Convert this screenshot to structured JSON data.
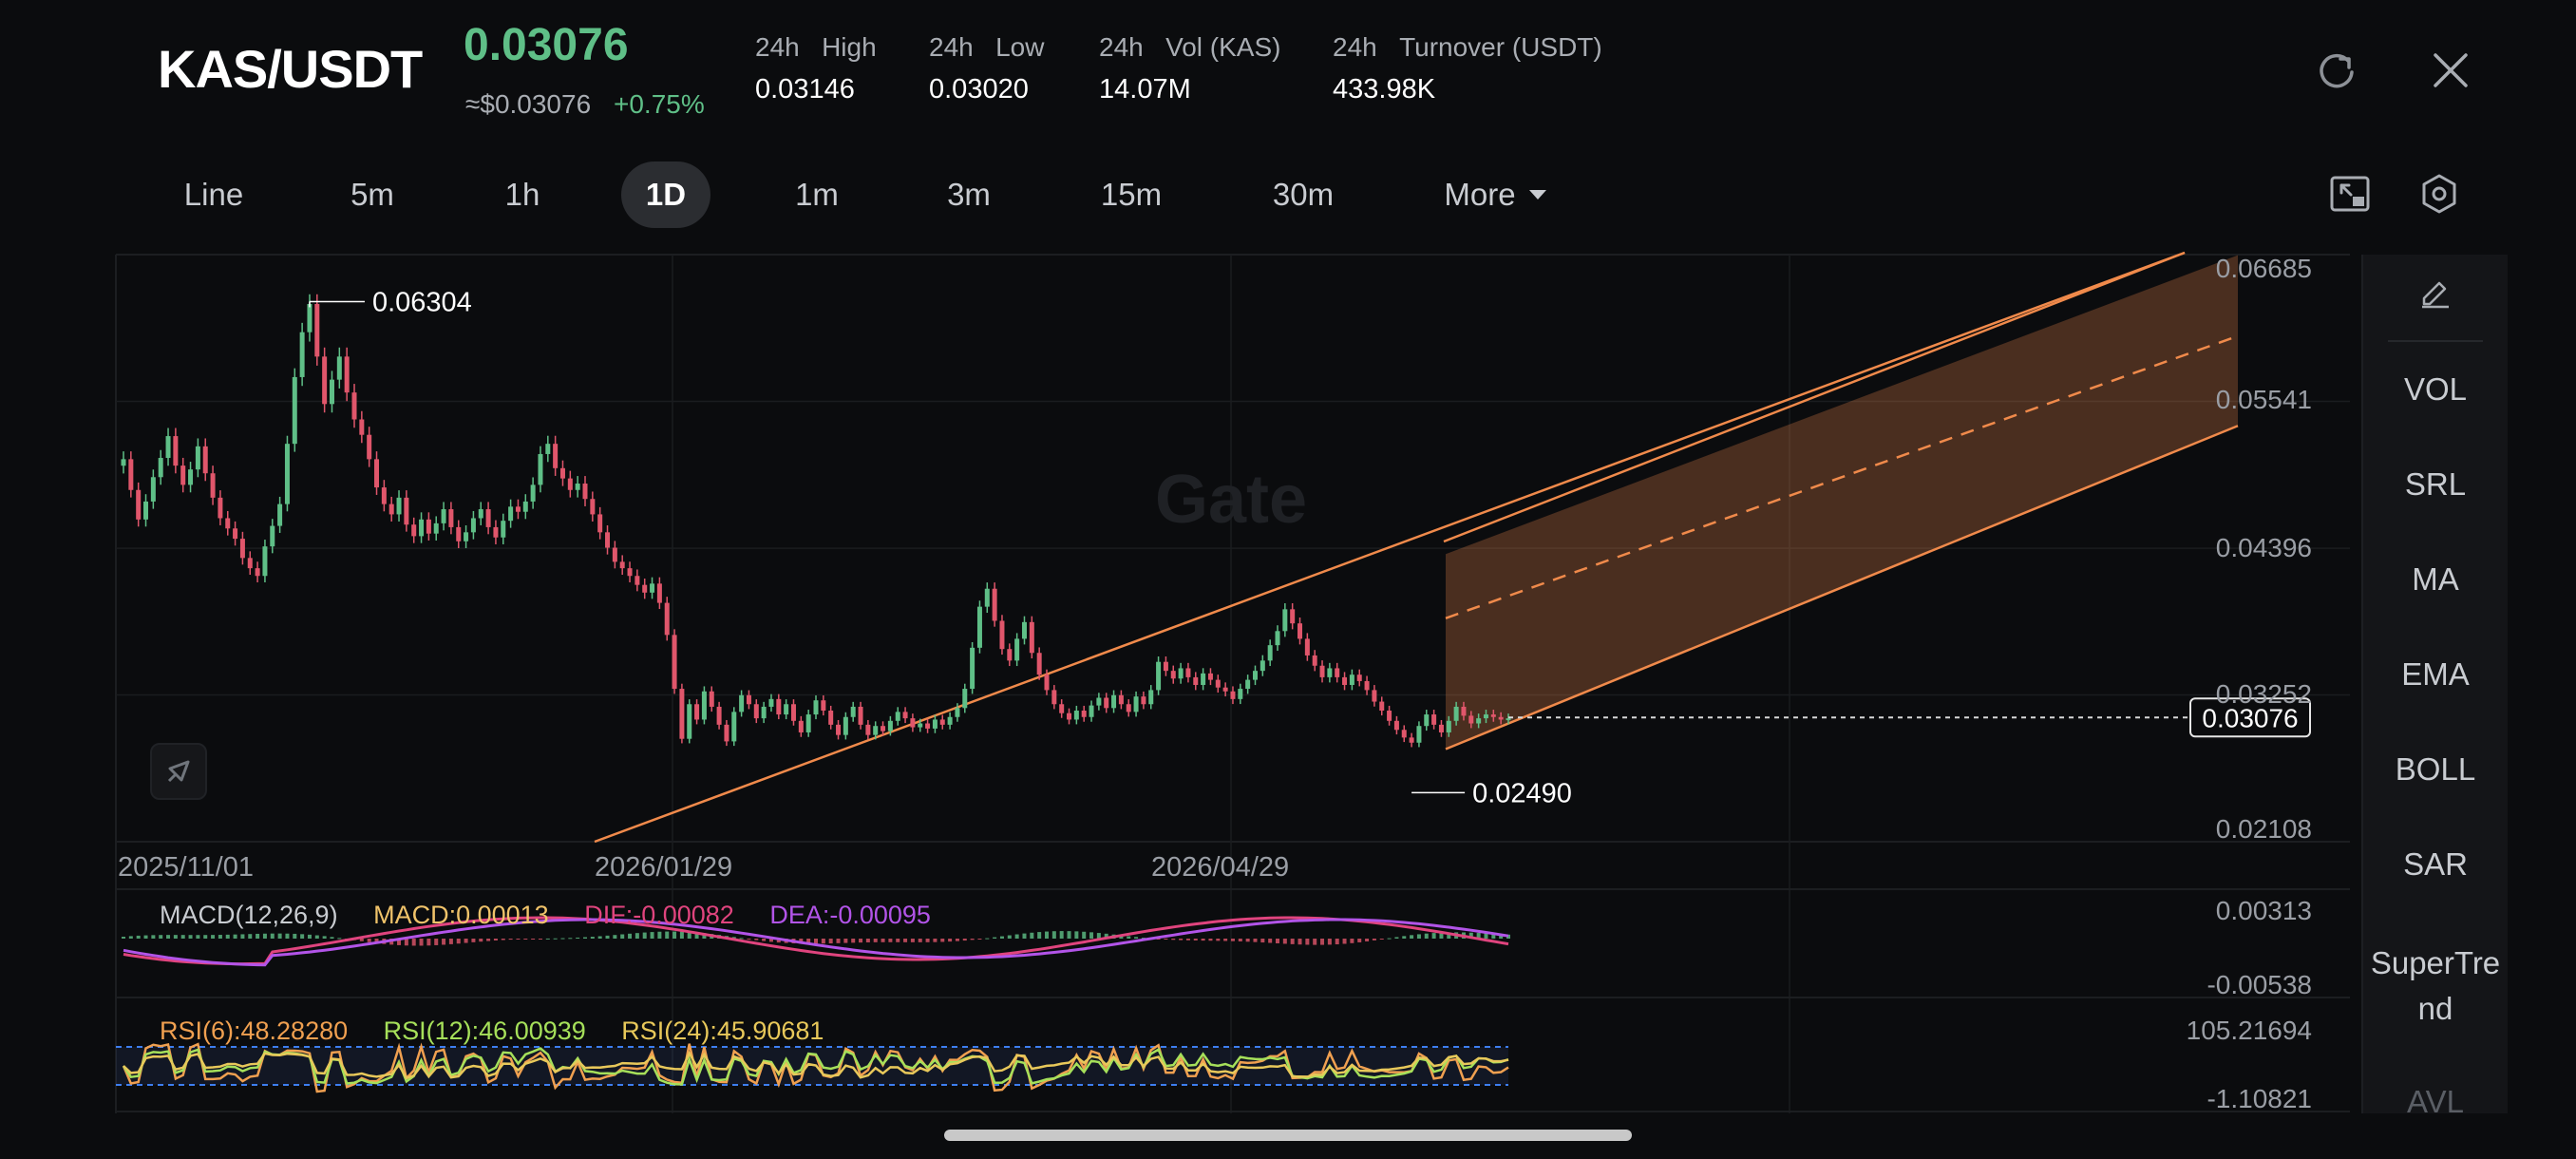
{
  "header": {
    "pair": "KAS/USDT",
    "price": "0.03076",
    "approx_usd": "≈$0.03076",
    "change": "+0.75%",
    "stats": [
      {
        "period": "24h",
        "label": "High",
        "value": "0.03146"
      },
      {
        "period": "24h",
        "label": "Low",
        "value": "0.03020"
      },
      {
        "period": "24h",
        "label": "Vol (KAS)",
        "value": "14.07M"
      },
      {
        "period": "24h",
        "label": "Turnover (USDT)",
        "value": "433.98K"
      }
    ]
  },
  "tabs": [
    "Line",
    "5m",
    "1h",
    "1D",
    "1m",
    "3m",
    "15m",
    "30m"
  ],
  "active_tab": "1D",
  "more_label": "More",
  "watermark": "Gate",
  "price_axis": [
    "0.06685",
    "0.05541",
    "0.04396",
    "0.03252",
    "0.02108"
  ],
  "current_price_label": "0.03076",
  "high_marker": "0.06304",
  "low_marker": "0.02490",
  "dates": [
    "2025/11/01",
    "2026/01/29",
    "2026/04/29"
  ],
  "macd": {
    "title": "MACD(12,26,9)",
    "macd": "MACD:0.00013",
    "dif": "DIF:-0.00082",
    "dea": "DEA:-0.00095",
    "axis_top": "0.00313",
    "axis_bottom": "-0.00538"
  },
  "rsi": {
    "rsi6": "RSI(6):48.28280",
    "rsi12": "RSI(12):46.00939",
    "rsi24": "RSI(24):45.90681",
    "axis_top": "105.21694",
    "axis_bottom": "-1.10821"
  },
  "indicators": [
    "VOL",
    "SRL",
    "MA",
    "EMA",
    "BOLL",
    "SAR",
    "SuperTrend",
    "AVL"
  ],
  "colors": {
    "up": "#5fbf87",
    "down": "#e0566b",
    "trend": "#f08a4b",
    "macd": "#f0c36a",
    "dif": "#e0447e",
    "dea": "#b254e8",
    "rsi6": "#f0a050",
    "rsi12": "#a6e05a",
    "rsi24": "#e8c85a"
  },
  "chart_data": {
    "type": "candlestick",
    "interval": "1D",
    "x_start": "2025/11/01",
    "y_range": [
      0.02108,
      0.06685
    ],
    "high": 0.06304,
    "low": 0.0249,
    "last": 0.03076,
    "closes": [
      0.0509,
      0.0485,
      0.0462,
      0.0476,
      0.0495,
      0.051,
      0.0527,
      0.0504,
      0.0489,
      0.0501,
      0.0519,
      0.0498,
      0.0479,
      0.0463,
      0.0455,
      0.0447,
      0.0432,
      0.0424,
      0.0418,
      0.0441,
      0.0457,
      0.0474,
      0.0521,
      0.0573,
      0.0608,
      0.063,
      0.0589,
      0.0552,
      0.0571,
      0.0589,
      0.0561,
      0.054,
      0.0528,
      0.0509,
      0.0487,
      0.0474,
      0.0466,
      0.0479,
      0.0458,
      0.0449,
      0.0462,
      0.0451,
      0.0459,
      0.047,
      0.0456,
      0.0445,
      0.0452,
      0.0463,
      0.047,
      0.0456,
      0.0448,
      0.0461,
      0.0472,
      0.0468,
      0.0476,
      0.0489,
      0.0513,
      0.0521,
      0.0502,
      0.0494,
      0.0485,
      0.049,
      0.0478,
      0.0466,
      0.0452,
      0.044,
      0.0429,
      0.0424,
      0.0418,
      0.0411,
      0.0405,
      0.0412,
      0.0397,
      0.0372,
      0.033,
      0.0291,
      0.0318,
      0.0306,
      0.0328,
      0.0316,
      0.0302,
      0.0289,
      0.0312,
      0.0325,
      0.0318,
      0.0307,
      0.0316,
      0.0322,
      0.031,
      0.0318,
      0.0305,
      0.0296,
      0.031,
      0.0321,
      0.0313,
      0.0302,
      0.0294,
      0.0308,
      0.0316,
      0.0302,
      0.0294,
      0.0301,
      0.0297,
      0.0305,
      0.0312,
      0.0307,
      0.03,
      0.0303,
      0.0299,
      0.0306,
      0.0302,
      0.0308,
      0.0315,
      0.033,
      0.0362,
      0.0394,
      0.0408,
      0.0383,
      0.0361,
      0.0352,
      0.0369,
      0.0382,
      0.0358,
      0.0341,
      0.0329,
      0.0318,
      0.0311,
      0.0306,
      0.0313,
      0.0308,
      0.0317,
      0.0323,
      0.0315,
      0.0325,
      0.0318,
      0.0312,
      0.0324,
      0.0318,
      0.0329,
      0.0351,
      0.0344,
      0.0338,
      0.0346,
      0.0339,
      0.0333,
      0.0342,
      0.0337,
      0.0331,
      0.0328,
      0.0322,
      0.033,
      0.0337,
      0.0344,
      0.0352,
      0.0364,
      0.0375,
      0.0392,
      0.0381,
      0.0369,
      0.0356,
      0.0348,
      0.0339,
      0.0346,
      0.0339,
      0.0333,
      0.0341,
      0.0336,
      0.0329,
      0.032,
      0.0313,
      0.0305,
      0.0298,
      0.0292,
      0.0288,
      0.0301,
      0.031,
      0.0302,
      0.0296,
      0.0305,
      0.0316,
      0.0309,
      0.0303,
      0.0307,
      0.031,
      0.0308,
      0.0306,
      0.0307
    ]
  },
  "projection": {
    "type": "regression-channel",
    "upper_end": 0.0668,
    "mid_end": 0.0605,
    "lower_end": 0.0535
  }
}
